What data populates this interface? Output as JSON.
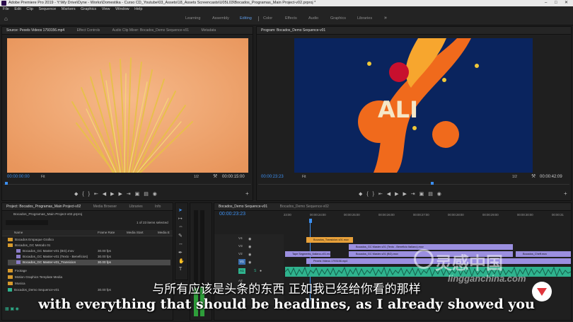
{
  "window": {
    "title": "Adobe Premiere Pro 2019 - Y:\\My Drive\\Dyne - Works\\Domestika - Curso CD_Youtube\\03_Assets\\18_Assets Screencasts\\U05L03\\Bocados_Programas_Main Project-v02.prproj *"
  },
  "menu": [
    "File",
    "Edit",
    "Clip",
    "Sequence",
    "Markers",
    "Graphics",
    "View",
    "Window",
    "Help"
  ],
  "workspaces": [
    "Learning",
    "Assembly",
    "Editing",
    "Color",
    "Effects",
    "Audio",
    "Graphics",
    "Libraries"
  ],
  "active_workspace": "Editing",
  "source_monitor": {
    "tabs": [
      "Source: Pexels Videos 1793156.mp4",
      "Effect Controls",
      "Audio Clip Mixer: Bocados_Demo Sequence-v01",
      "Metadata"
    ],
    "timecode_in": "00:00:00:00",
    "fit": "Fit",
    "ratio": "1/2",
    "duration": "00:00:15:00"
  },
  "program_monitor": {
    "tab": "Program: Bocados_Demo Sequence-v01",
    "timecode": "00:00:23:23",
    "fit": "Fit",
    "ratio": "1/2",
    "duration": "00:00:42:09"
  },
  "project": {
    "tabs": [
      "Project: Bocados_Programas_Main Project-v02",
      "Media Browser",
      "Libraries",
      "Info"
    ],
    "path": "Bocados_Programas_Main Project-v02.prproj",
    "selection": "1 of 23 items selected",
    "columns": [
      "Name",
      "Frame Rate",
      "Media Start",
      "Media E"
    ],
    "rows": [
      {
        "name": "Bocados Empaque Grafico",
        "rate": "",
        "type": "folder"
      },
      {
        "name": "Bocados_GC Metodo 01",
        "rate": "",
        "type": "folder"
      },
      {
        "name": "Bocados_GC Master-v01 (BG).mov",
        "rate": "30.00 fps",
        "type": "clip"
      },
      {
        "name": "Bocados_GC Master-v01 (Texto - Beneficios)",
        "rate": "30.00 fps",
        "type": "clip"
      },
      {
        "name": "Bocados_GC Master-v01_Transicion",
        "rate": "30.00 fps",
        "type": "clip"
      },
      {
        "name": "Footage",
        "rate": "",
        "type": "folder"
      },
      {
        "name": "Motion Graphics Template Media",
        "rate": "",
        "type": "folder"
      },
      {
        "name": "Musica",
        "rate": "",
        "type": "folder"
      },
      {
        "name": "Bocados_Demo Sequence-v01",
        "rate": "30.00 fps",
        "type": "seq"
      }
    ]
  },
  "timeline": {
    "tab": "Bocados_Demo Sequence-v01",
    "tab2": "Bocados_Demo Sequence-v02",
    "timecode": "00:00:23:23",
    "ruler": [
      "23:00",
      "00:00:24:00",
      "00:00:25:00",
      "00:00:26:00",
      "00:00:27:00",
      "00:00:28:00",
      "00:00:29:00",
      "00:00:30:00",
      "00:00:31"
    ],
    "tracks": [
      "V4",
      "V3",
      "V2",
      "V1",
      "A1",
      "A2"
    ],
    "clips": [
      {
        "label": "Bocados_Transicion-v01.mov"
      },
      {
        "label": "Bocados_GC Master-v01 (Texto - Beneficio Italiano).mov"
      },
      {
        "label": "Tape Segments_Italiano-v01.mov"
      },
      {
        "label": "Bocados_GC Master-v01 (BG).mov"
      },
      {
        "label": "Bocados_Cheff.mov"
      },
      {
        "label": "Pexels Videos 1793156.mp4"
      }
    ]
  },
  "subtitles": {
    "zh": "与所有应该是头条的东西 正如我已经给你看的那样",
    "en": "with everything that should be headlines, as I already showed you"
  },
  "watermark": {
    "zh": "灵感中国",
    "en": "lingganchina.com"
  },
  "colors": {
    "accent_blue": "#3c8ff0",
    "clip_orange": "#e8a13a",
    "clip_purple": "#9b8fe0",
    "audio_green": "#2fb38e"
  }
}
